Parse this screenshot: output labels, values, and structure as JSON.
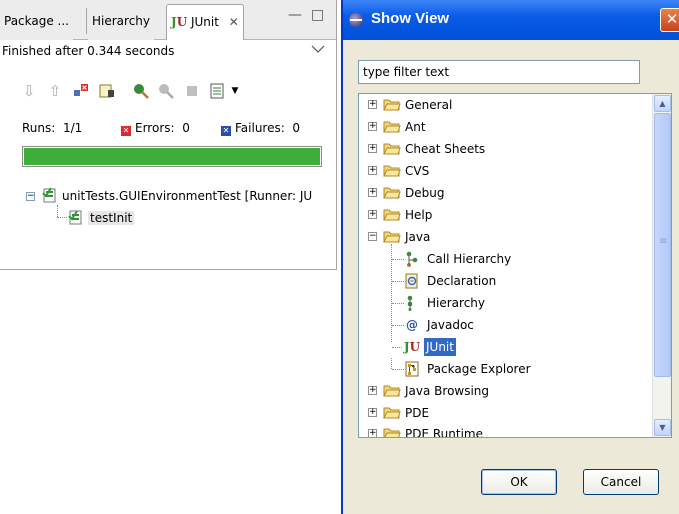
{
  "junit_view": {
    "tabs": [
      {
        "label": "Package ..."
      },
      {
        "label": "Hierarchy"
      },
      {
        "label": "JUnit",
        "icon": "junit-icon",
        "close": "✕"
      }
    ],
    "status": "Finished after 0.344 seconds",
    "counters": {
      "runs_label": "Runs:",
      "runs_value": "1/1",
      "errors_label": "Errors:",
      "errors_value": "0",
      "failures_label": "Failures:",
      "failures_value": "0"
    },
    "progress": {
      "fraction": 1.0,
      "color": "#3fad3a"
    },
    "tree": {
      "suite_label": "unitTests.GUIEnvironmentTest [Runner: JU",
      "test_label": "testInit"
    }
  },
  "show_view": {
    "title": "Show View",
    "close_glyph": "✕",
    "filter_value": "type filter text",
    "categories": [
      {
        "label": "General",
        "expanded": false
      },
      {
        "label": "Ant",
        "expanded": false
      },
      {
        "label": "Cheat Sheets",
        "expanded": false
      },
      {
        "label": "CVS",
        "expanded": false
      },
      {
        "label": "Debug",
        "expanded": false
      },
      {
        "label": "Help",
        "expanded": false
      },
      {
        "label": "Java",
        "expanded": true
      }
    ],
    "java_children": [
      {
        "label": "Call Hierarchy",
        "icon": "call-hierarchy-icon"
      },
      {
        "label": "Declaration",
        "icon": "declaration-icon"
      },
      {
        "label": "Hierarchy",
        "icon": "hierarchy-icon"
      },
      {
        "label": "Javadoc",
        "icon": "javadoc-icon"
      },
      {
        "label": "JUnit",
        "icon": "junit-icon",
        "selected": true
      },
      {
        "label": "Package Explorer",
        "icon": "package-explorer-icon"
      }
    ],
    "more_categories": [
      {
        "label": "Java Browsing"
      },
      {
        "label": "PDE"
      },
      {
        "label": "PDE Runtime"
      }
    ],
    "ok_label": "OK",
    "cancel_label": "Cancel",
    "accent": "#0a5ce6",
    "selection_color": "#316ac5"
  }
}
